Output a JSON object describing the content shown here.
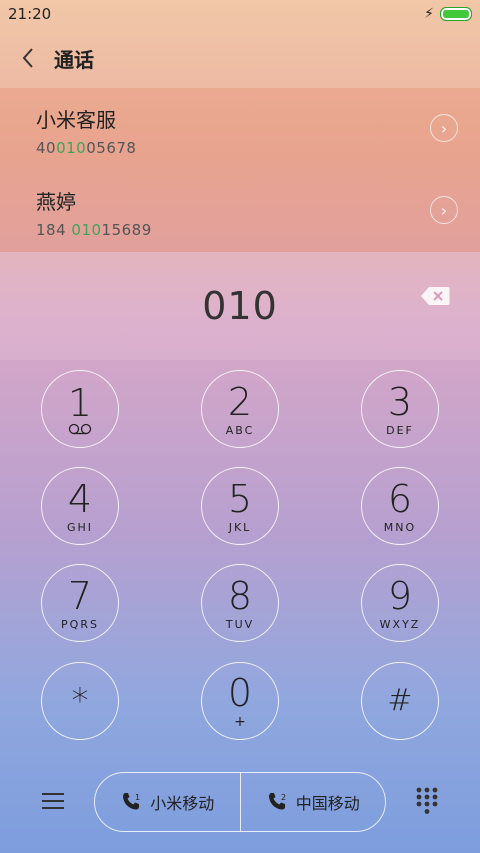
{
  "status": {
    "time": "21:20"
  },
  "header": {
    "title": "通话"
  },
  "results": [
    {
      "name": "小米客服",
      "number_pre": "40",
      "number_match": "010",
      "number_post": "05678"
    },
    {
      "name": "燕婷",
      "number_pre": "184 ",
      "number_match": "010",
      "number_post": "15689"
    }
  ],
  "input": {
    "dialed": "010"
  },
  "keypad": [
    {
      "digit": "1",
      "letters": ""
    },
    {
      "digit": "2",
      "letters": "ABC"
    },
    {
      "digit": "3",
      "letters": "DEF"
    },
    {
      "digit": "4",
      "letters": "GHI"
    },
    {
      "digit": "5",
      "letters": "JKL"
    },
    {
      "digit": "6",
      "letters": "MNO"
    },
    {
      "digit": "7",
      "letters": "PQRS"
    },
    {
      "digit": "8",
      "letters": "TUV"
    },
    {
      "digit": "9",
      "letters": "WXYZ"
    },
    {
      "digit": "*",
      "letters": ""
    },
    {
      "digit": "0",
      "letters": "+"
    },
    {
      "digit": "#",
      "letters": ""
    }
  ],
  "bottom": {
    "sim1_label": "小米移动",
    "sim2_label": "中国移动"
  },
  "colors": {
    "match_highlight": "#3aa65a",
    "battery": "#41c83b"
  }
}
